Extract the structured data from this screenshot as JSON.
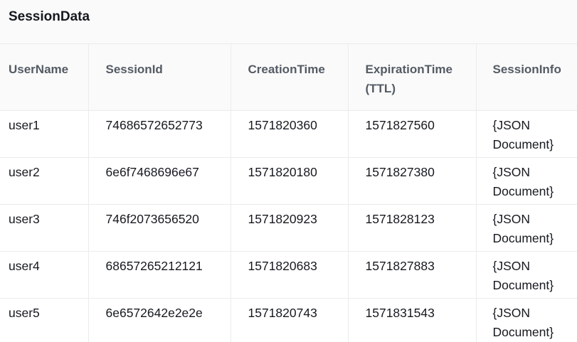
{
  "title": "SessionData",
  "columns": [
    "UserName",
    "SessionId",
    "CreationTime",
    "ExpirationTime (TTL)",
    "SessionInfo"
  ],
  "rows": [
    {
      "user_name": "user1",
      "session_id": "74686572652773",
      "creation_time": "1571820360",
      "expiration_time": "1571827560",
      "session_info": "{JSON Document}"
    },
    {
      "user_name": "user2",
      "session_id": "6e6f7468696e67",
      "creation_time": "1571820180",
      "expiration_time": "1571827380",
      "session_info": "{JSON Document}"
    },
    {
      "user_name": "user3",
      "session_id": "746f2073656520",
      "creation_time": "1571820923",
      "expiration_time": "1571828123",
      "session_info": "{JSON Document}"
    },
    {
      "user_name": "user4",
      "session_id": "68657265212121",
      "creation_time": "1571820683",
      "expiration_time": "1571827883",
      "session_info": "{JSON Document}"
    },
    {
      "user_name": "user5",
      "session_id": "6e6572642e2e2e",
      "creation_time": "1571820743",
      "expiration_time": "1571831543",
      "session_info": "{JSON Document}"
    }
  ]
}
